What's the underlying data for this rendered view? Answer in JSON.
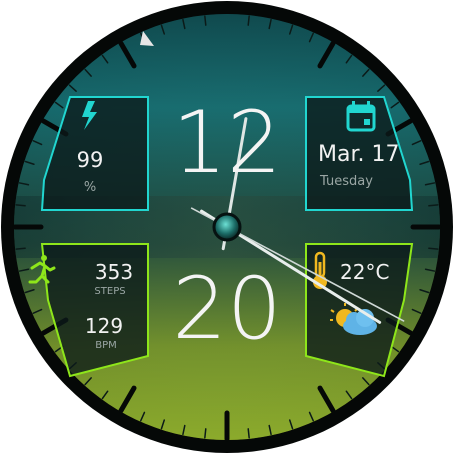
{
  "time": {
    "hour": "12",
    "minute": "20"
  },
  "battery": {
    "icon": "battery-charging-icon",
    "value": "99",
    "unit": "%",
    "accent": "#21d6d0"
  },
  "date": {
    "icon": "calendar-icon",
    "date": "Mar. 17",
    "weekday": "Tuesday",
    "accent": "#21d6d0"
  },
  "activity": {
    "icon": "running-icon",
    "steps": "353",
    "steps_label": "STEPS",
    "heart": "129",
    "heart_label": "BPM",
    "accent": "#8ee61a"
  },
  "weather": {
    "thermometer_icon": "thermometer-icon",
    "temperature": "22°C",
    "condition_icon": "partly-cloudy-icon",
    "accent": "#f0b820"
  },
  "hands": {
    "hour_value": 12.33,
    "minute_value": 20
  },
  "colors": {
    "teal": "#1e8f93",
    "lime": "#aac81e",
    "bezel": "#0b1211"
  }
}
